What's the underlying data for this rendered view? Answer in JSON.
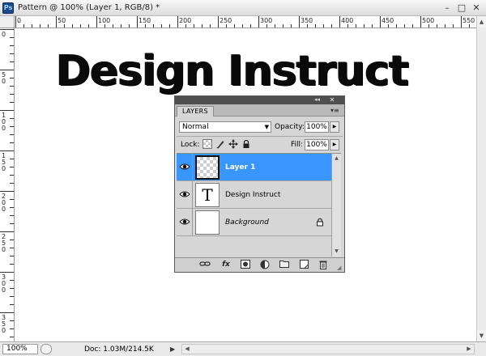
{
  "window": {
    "app_icon_label": "Ps",
    "title": "Pattern @ 100% (Layer 1, RGB/8) *",
    "minimize": "–",
    "maximize": "□",
    "close": "✕"
  },
  "rulers": {
    "horizontal_labels": [
      "0",
      "50",
      "100",
      "150",
      "200",
      "250",
      "300",
      "350",
      "400",
      "450",
      "500",
      "550"
    ],
    "vertical_labels": [
      "0",
      "50",
      "100",
      "150",
      "200",
      "250",
      "300",
      "350"
    ]
  },
  "canvas": {
    "text": "Design Instruct"
  },
  "status": {
    "zoom": "100%",
    "doc_info": "Doc: 1.03M/214.5K",
    "arrow": "▶"
  },
  "layers_panel": {
    "collapse_glyph": "◂◂",
    "close_glyph": "✕",
    "tab_label": "LAYERS",
    "menu_glyph": "▾≡",
    "blend_mode": "Normal",
    "opacity_label": "Opacity:",
    "opacity_value": "100%",
    "lock_label": "Lock:",
    "fill_label": "Fill:",
    "fill_value": "100%",
    "layers": [
      {
        "name": "Layer 1",
        "selected": true,
        "thumb": "transparent"
      },
      {
        "name": "Design Instruct",
        "selected": false,
        "thumb": "T"
      },
      {
        "name": "Background",
        "selected": false,
        "thumb": "white",
        "locked": true
      }
    ],
    "footer_icons": [
      "link-layers-icon",
      "fx-icon",
      "layer-mask-icon",
      "adjustment-layer-icon",
      "new-group-icon",
      "new-layer-icon",
      "trash-icon"
    ],
    "colors": {
      "selection": "#3a96ff",
      "panel_bg": "#d6d6d6",
      "panel_topbar": "#4f4f4f"
    }
  }
}
